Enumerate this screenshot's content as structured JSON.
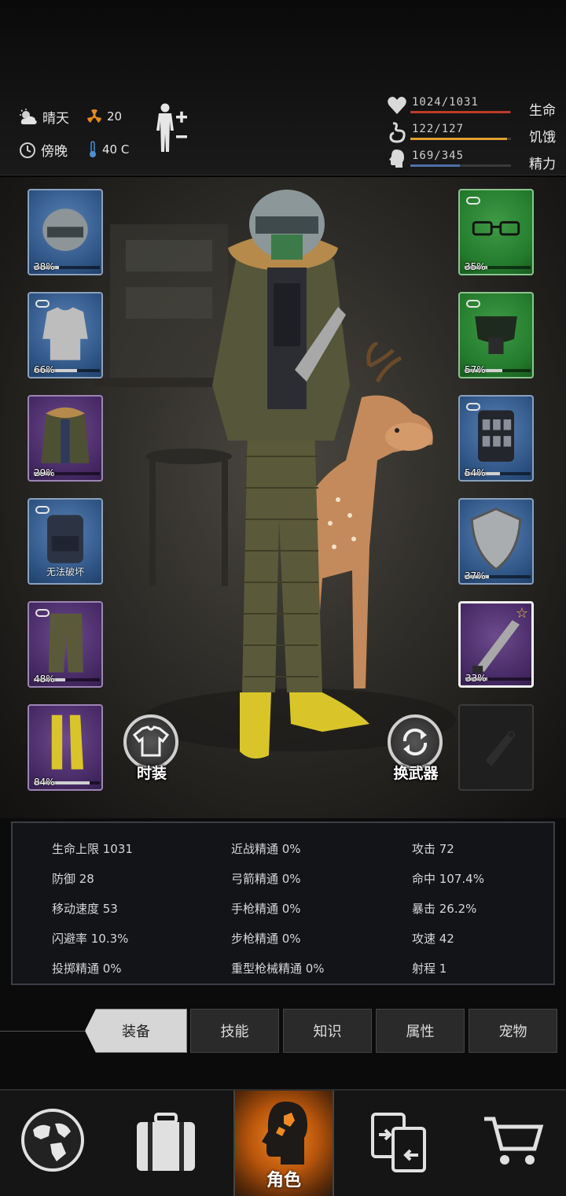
{
  "status": {
    "weather": "晴天",
    "radiation": "20",
    "time_of_day": "傍晚",
    "temperature": "40 C",
    "bars": [
      {
        "name": "health",
        "value": "1024/1031",
        "label": "生命",
        "fraction": 0.993,
        "color": "#c0392b"
      },
      {
        "name": "hunger",
        "value": "122/127",
        "label": "饥饿",
        "fraction": 0.96,
        "color": "#e0a030"
      },
      {
        "name": "energy",
        "value": "169/345",
        "label": "精力",
        "fraction": 0.49,
        "color": "#4d6fa8"
      }
    ]
  },
  "slots_left": [
    {
      "name": "helmet",
      "rarity": "blue",
      "durability": "38%",
      "fraction": 0.38,
      "linked": false
    },
    {
      "name": "shirt",
      "rarity": "blue",
      "durability": "66%",
      "fraction": 0.66,
      "linked": true
    },
    {
      "name": "jacket",
      "rarity": "purple",
      "durability": "29%",
      "fraction": 0.29,
      "linked": false
    },
    {
      "name": "backpack",
      "rarity": "blue",
      "durability": "无法破坏",
      "fraction": null,
      "linked": true
    },
    {
      "name": "pants",
      "rarity": "purple",
      "durability": "48%",
      "fraction": 0.48,
      "linked": true
    },
    {
      "name": "boots",
      "rarity": "purple",
      "durability": "84%",
      "fraction": 0.84,
      "linked": false
    }
  ],
  "slots_right": [
    {
      "name": "glasses",
      "rarity": "green",
      "durability": "35%",
      "fraction": 0.35,
      "linked": true
    },
    {
      "name": "mask",
      "rarity": "green",
      "durability": "57%",
      "fraction": 0.57,
      "linked": true
    },
    {
      "name": "vest",
      "rarity": "blue",
      "durability": "54%",
      "fraction": 0.54,
      "linked": true
    },
    {
      "name": "shield",
      "rarity": "blue",
      "durability": "37%",
      "fraction": 0.37,
      "linked": false
    },
    {
      "name": "machete",
      "rarity": "purple",
      "durability": "33%",
      "fraction": 0.33,
      "linked": false,
      "selected": true,
      "starred": true
    },
    {
      "name": "empty-slot",
      "rarity": "empty",
      "durability": "",
      "fraction": null,
      "linked": false
    }
  ],
  "buttons": {
    "costume": "时装",
    "swap_weapon": "换武器"
  },
  "stats": {
    "col1": [
      "生命上限 1031",
      "防御 28",
      "移动速度 53",
      "闪避率 10.3%",
      "投掷精通 0%"
    ],
    "col2": [
      "近战精通 0%",
      "弓箭精通 0%",
      "手枪精通 0%",
      "步枪精通 0%",
      "重型枪械精通 0%"
    ],
    "col3": [
      "攻击 72",
      "命中 107.4%",
      "暴击 26.2%",
      "攻速 42",
      "射程 1"
    ]
  },
  "tabs": [
    "装备",
    "技能",
    "知识",
    "属性",
    "宠物"
  ],
  "active_tab": "装备",
  "nav": {
    "active_label": "角色",
    "items": [
      "world-map-icon",
      "luggage-icon",
      "character-icon",
      "trade-icon",
      "shop-cart-icon"
    ]
  },
  "colors": {
    "rarity_blue": "#2f5585",
    "rarity_purple": "#472a66",
    "rarity_green": "#237a2c",
    "nav_active": "#e07a1c"
  }
}
